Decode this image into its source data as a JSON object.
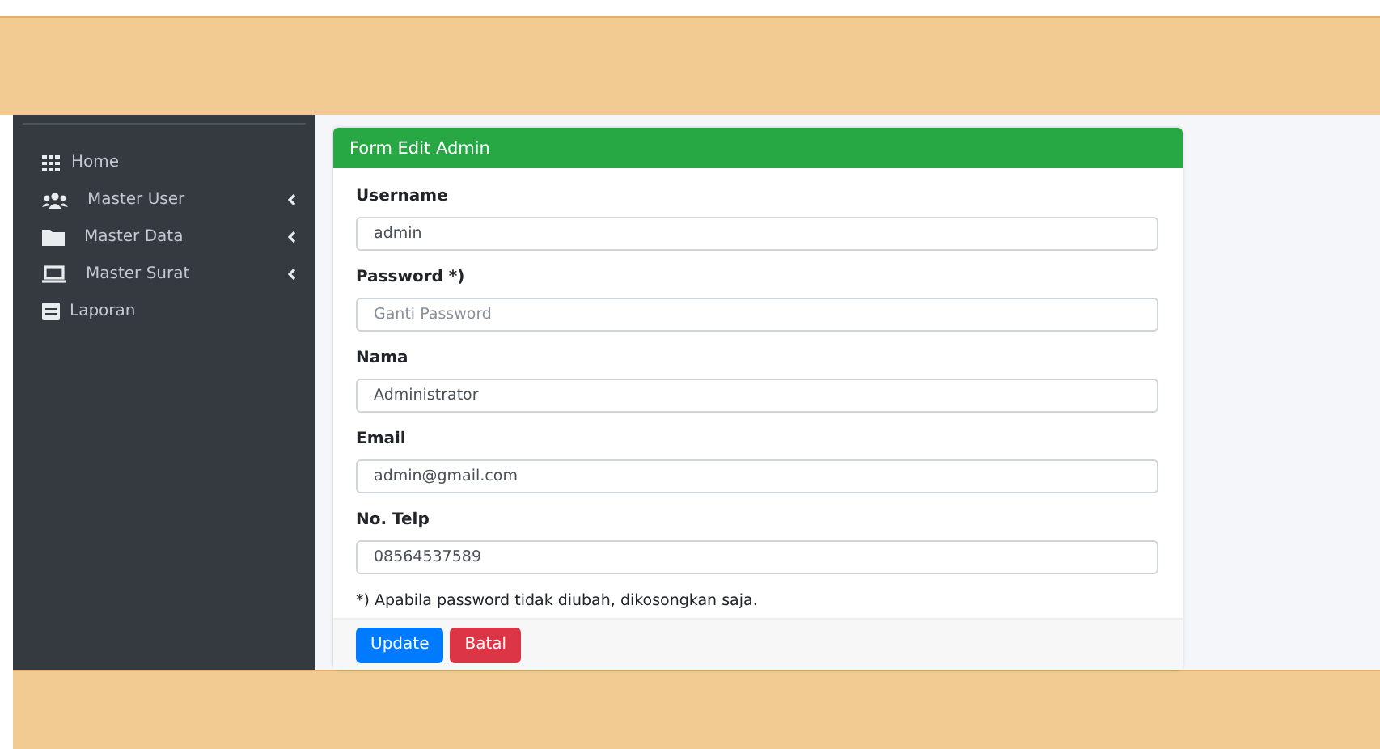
{
  "sidebar": {
    "items": [
      {
        "label": "Home",
        "kind": "grid",
        "submenu": false
      },
      {
        "label": "Master User",
        "kind": "users",
        "submenu": true
      },
      {
        "label": "Master Data",
        "kind": "folder",
        "submenu": true
      },
      {
        "label": "Master Surat",
        "kind": "laptop",
        "submenu": true
      },
      {
        "label": "Laporan",
        "kind": "report",
        "submenu": false
      }
    ]
  },
  "form": {
    "title": "Form Edit Admin",
    "fields": [
      {
        "label": "Username",
        "value": "admin"
      },
      {
        "label": "Password *)",
        "placeholder": "Ganti Password"
      },
      {
        "label": "Nama",
        "value": "Administrator"
      },
      {
        "label": "Email",
        "value": "admin@gmail.com"
      },
      {
        "label": "No. Telp",
        "value": "08564537589"
      }
    ],
    "note": "*) Apabila password tidak diubah, dikosongkan saja.",
    "buttons": [
      {
        "label": "Update",
        "kind": "primary"
      },
      {
        "label": "Batal",
        "kind": "danger"
      }
    ]
  }
}
